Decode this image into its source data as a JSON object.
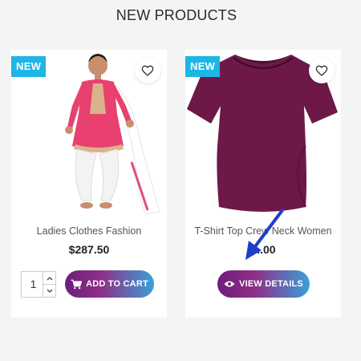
{
  "section": {
    "title": "NEW PRODUCTS"
  },
  "colors": {
    "badge": "#1eb6e6",
    "button_gradient_start": "#6b1f7a",
    "button_gradient_end": "#3aa0d8"
  },
  "products": [
    {
      "badge": "NEW",
      "name": "Ladies Clothes Fashion",
      "price": "$287.50",
      "quantity": "1",
      "action_label": "ADD TO CART",
      "action_icon": "shopping-cart-icon"
    },
    {
      "badge": "NEW",
      "name": "T-Shirt Top Crew Neck Women",
      "price": "$..00",
      "action_label": "VIEW DETAILS",
      "action_icon": "eye-icon"
    }
  ]
}
